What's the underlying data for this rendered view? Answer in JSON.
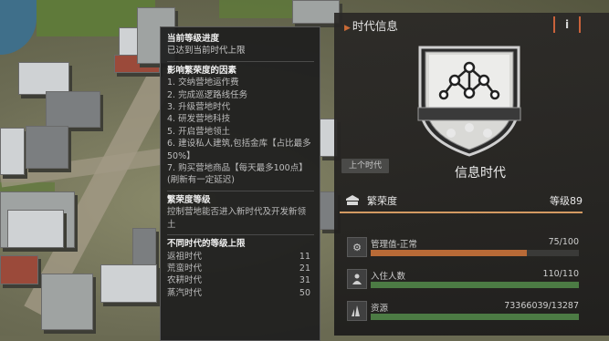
{
  "tooltip": {
    "level_progress_title": "当前等级进度",
    "level_progress_desc": "已达到当前时代上限",
    "factors_title": "影响繁荣度的因素",
    "factors": [
      "1. 交纳营地运作费",
      "2. 完成巡逻路线任务",
      "3. 升级营地时代",
      "4. 研发营地科技",
      "5. 开启营地领土",
      "6. 建设私人建筑,包括金库【占比最多50%】",
      "7. 购买营地商品【每天最多100点】(刷新有一定延迟)"
    ],
    "pros_level_title": "繁荣度等级",
    "pros_level_desc": "控制营地能否进入新时代及开发新领土",
    "caps_title": "不同时代的等级上限",
    "caps": [
      {
        "era": "返祖时代",
        "cap": "11"
      },
      {
        "era": "荒蛮时代",
        "cap": "21"
      },
      {
        "era": "农耕时代",
        "cap": "31"
      },
      {
        "era": "蒸汽时代",
        "cap": "50"
      }
    ]
  },
  "panel": {
    "title": "时代信息",
    "info_label": "i",
    "prev_era_button": "上个时代",
    "era_name": "信息时代",
    "prosperity_label": "繁荣度",
    "prosperity_level": "等级89",
    "stats": [
      {
        "name": "management",
        "label": "管理值-正常",
        "value": "75/100",
        "fill": 0.75,
        "color": "#b86a37",
        "icon": "gear-icon"
      },
      {
        "name": "residents",
        "label": "入住人数",
        "value": "110/110",
        "fill": 1.0,
        "color": "#4c7b44",
        "icon": "people-icon"
      },
      {
        "name": "resources",
        "label": "资源",
        "value": "73366039/13287",
        "fill": 1.0,
        "color": "#4c7b44",
        "icon": "resource-icon"
      }
    ],
    "colors": {
      "accent": "#c9623b",
      "prosperity_line": "#d39a62",
      "bar_green": "#4c7b44",
      "bar_orange": "#b86a37"
    }
  }
}
